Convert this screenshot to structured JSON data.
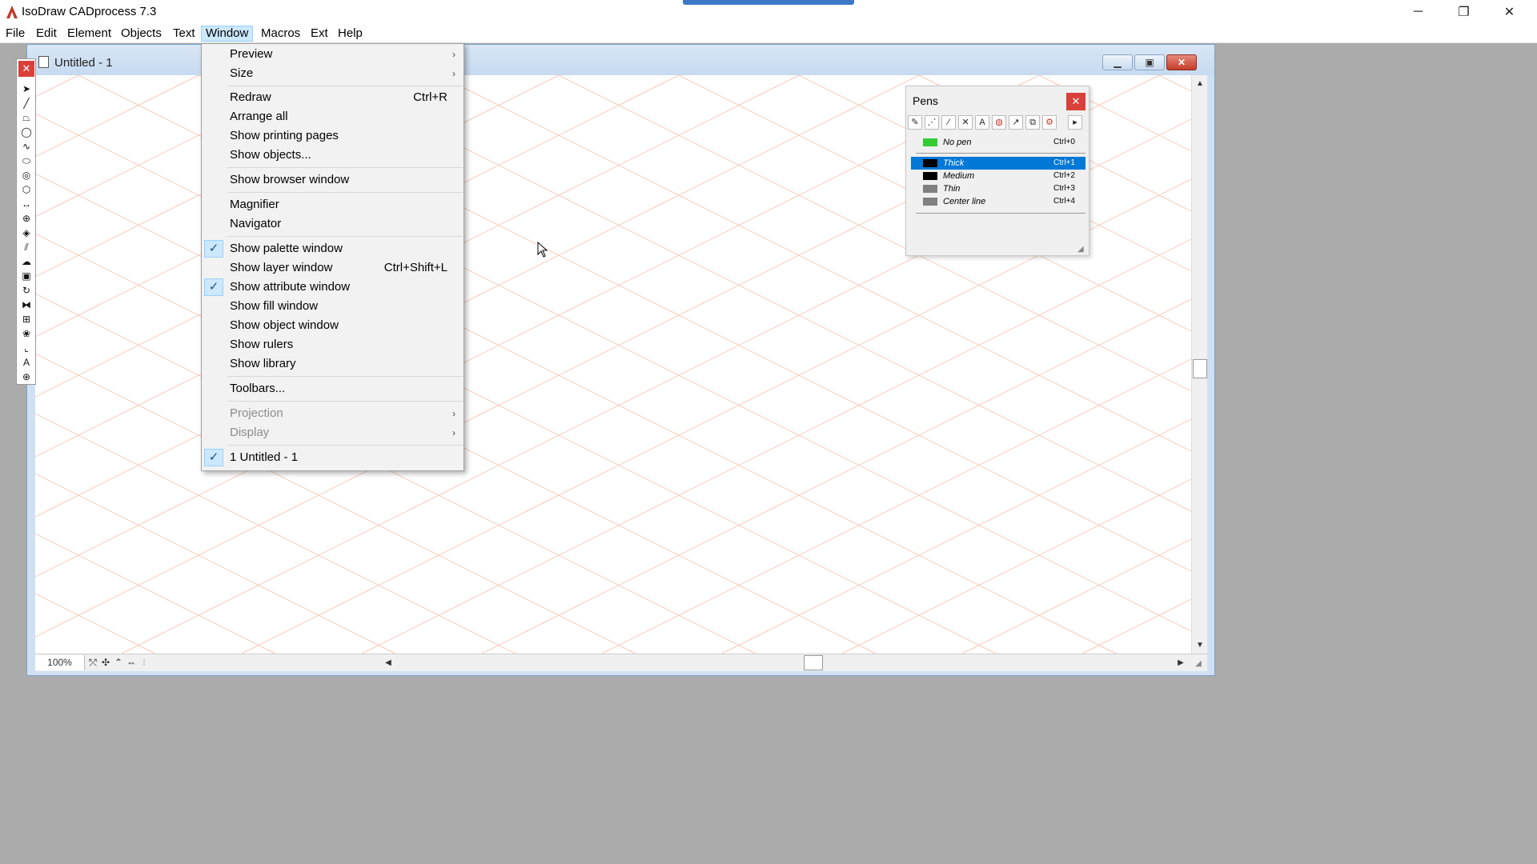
{
  "app": {
    "title": "IsoDraw CADprocess 7.3"
  },
  "window_controls": {
    "minimize": "─",
    "restore": "❐",
    "close": "✕"
  },
  "menubar": [
    "File",
    "Edit",
    "Element",
    "Objects",
    "Text",
    "Window",
    "Macros",
    "Ext",
    "Help"
  ],
  "document": {
    "title": "Untitled - 1",
    "zoom": "100%",
    "grid_color": "#f5c8b8"
  },
  "window_menu": {
    "preview": "Preview",
    "size": "Size",
    "redraw": "Redraw",
    "redraw_shortcut": "Ctrl+R",
    "arrange_all": "Arrange all",
    "show_printing_pages": "Show printing pages",
    "show_objects": "Show objects...",
    "show_browser_window": "Show browser window",
    "magnifier": "Magnifier",
    "navigator": "Navigator",
    "show_palette_window": "Show palette window",
    "show_layer_window": "Show layer window",
    "show_layer_window_shortcut": "Ctrl+Shift+L",
    "show_attribute_window": "Show attribute window",
    "show_fill_window": "Show fill window",
    "show_object_window": "Show object window",
    "show_rulers": "Show rulers",
    "show_library": "Show library",
    "toolbars": "Toolbars...",
    "projection": "Projection",
    "display": "Display",
    "untitled_1": "1 Untitled - 1"
  },
  "pens": {
    "title": "Pens",
    "rows": [
      {
        "label": "No pen",
        "shortcut": "Ctrl+0",
        "color": "#33cc33"
      },
      {
        "label": "Thick",
        "shortcut": "Ctrl+1",
        "color": "#000000",
        "selected": true
      },
      {
        "label": "Medium",
        "shortcut": "Ctrl+2",
        "color": "#000000"
      },
      {
        "label": "Thin",
        "shortcut": "Ctrl+3",
        "color": "#808080"
      },
      {
        "label": "Center line",
        "shortcut": "Ctrl+4",
        "color": "#808080"
      }
    ]
  },
  "colors": {
    "selection": "#0078d7",
    "menu_highlight": "#cce8ff",
    "close_red": "#d9403a"
  }
}
